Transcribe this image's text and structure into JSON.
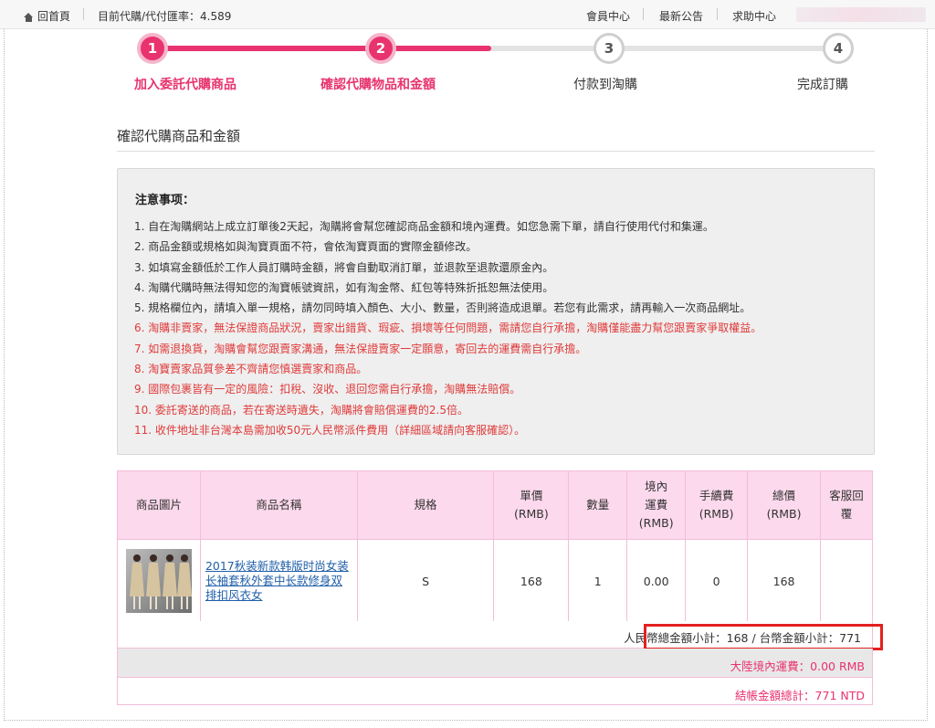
{
  "topbar": {
    "home": "回首頁",
    "rate": "目前代購/代付匯率：4.589",
    "member": "會員中心",
    "news": "最新公告",
    "help": "求助中心"
  },
  "steps": [
    {
      "num": "1",
      "label": "加入委託代購商品",
      "active": true
    },
    {
      "num": "2",
      "label": "確認代購物品和金額",
      "active": true
    },
    {
      "num": "3",
      "label": "付款到淘購",
      "active": false
    },
    {
      "num": "4",
      "label": "完成訂購",
      "active": false
    }
  ],
  "section_title": "確認代購商品和金額",
  "notice": {
    "title": "注意事项：",
    "items": [
      "1. 自在淘購網站上成立訂單後2天起，淘購將會幫您確認商品金額和境內運費。如您急需下單，請自行使用代付和集運。",
      "2. 商品金額或規格如與淘寶頁面不符，會依淘寶頁面的實際金額修改。",
      "3. 如填寫金額低於工作人員訂購時金額，將會自動取消訂單，並退款至退款還原金內。",
      "4. 淘購代購時無法得知您的淘寶帳號資訊，如有淘金幣、紅包等特殊折抵恕無法使用。",
      "5. 規格欄位內，請填入單一規格，請勿同時填入顏色、大小、數量，否則將造成退單。若您有此需求，請再輸入一次商品網址。",
      "6. 淘購非賣家，無法保證商品狀況，賣家出錯貨、瑕疵、損壞等任何問題，需請您自行承擔，淘購僅能盡力幫您跟賣家爭取權益。",
      "7. 如需退換貨，淘購會幫您跟賣家溝通，無法保證賣家一定願意，寄回去的運費需自行承擔。",
      "8. 淘寶賣家品質參差不齊請您慎選賣家和商品。",
      "9. 國際包裹皆有一定的風險：扣稅、沒收、退回您需自行承擔，淘購無法賠償。",
      "10. 委託寄送的商品，若在寄送時遺失，淘購將會賠償運費的2.5倍。",
      "11. 收件地址非台灣本島需加收50元人民幣派件費用（詳細區域請向客服確認）。"
    ]
  },
  "table": {
    "headers": [
      "商品圖片",
      "商品名稱",
      "規格",
      "單價\n(RMB)",
      "數量",
      "境內\n運費\n(RMB)",
      "手續費\n(RMB)",
      "總價\n(RMB)",
      "客服回\n覆"
    ],
    "row": {
      "name": "2017秋装新款韩版时尚女装长袖套秋外套中长款修身双排扣风衣女",
      "spec": "S",
      "price": "168",
      "qty": "1",
      "shipping": "0.00",
      "fee": "0",
      "total": "168",
      "reply": ""
    }
  },
  "summary": {
    "subtotal": "人民幣總金額小計：168 / 台幣金額小計：771",
    "mainland_shipping": "大陸境內運費：0.00 RMB",
    "grand_total": "結帳金額總計：771 NTD"
  },
  "colors": {
    "accent": "#e8336e",
    "highlight": "#e32020",
    "header_bg": "#fcd9ec"
  }
}
